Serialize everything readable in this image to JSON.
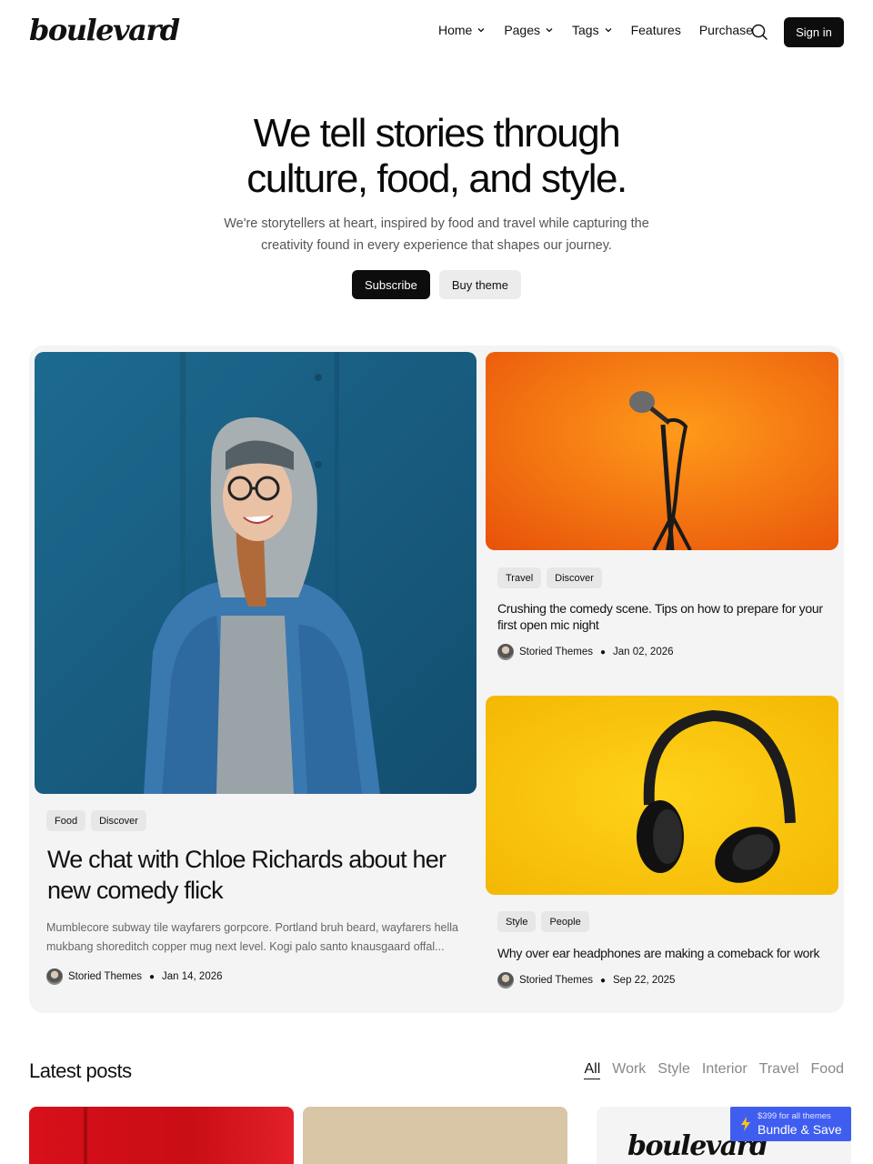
{
  "brand": {
    "logo": "boulevard"
  },
  "nav": {
    "items": [
      {
        "label": "Home",
        "dropdown": true
      },
      {
        "label": "Pages",
        "dropdown": true
      },
      {
        "label": "Tags",
        "dropdown": true
      },
      {
        "label": "Features",
        "dropdown": false
      },
      {
        "label": "Purchase",
        "dropdown": false
      }
    ],
    "search_icon": "search-icon",
    "signin_label": "Sign in"
  },
  "hero": {
    "title_line1": "We tell stories through",
    "title_line2": "culture, food, and style.",
    "subtitle": "We're storytellers at heart, inspired by food and travel while capturing the creativity found in every experience that shapes our journey.",
    "subscribe_label": "Subscribe",
    "buy_label": "Buy theme"
  },
  "featured": {
    "main": {
      "tags": [
        "Food",
        "Discover"
      ],
      "title": "We chat with Chloe Richards about her new comedy flick",
      "excerpt": "Mumblecore subway tile wayfarers gorpcore. Portland bruh beard, wayfarers hella mukbang shoreditch copper mug next level. Kogi palo santo knausgaard offal...",
      "author": "Storied Themes",
      "date": "Jan 14, 2026"
    },
    "side": [
      {
        "tags": [
          "Travel",
          "Discover"
        ],
        "title": "Crushing the comedy scene. Tips on how to prepare for your first open mic night",
        "author": "Storied Themes",
        "date": "Jan 02, 2026"
      },
      {
        "tags": [
          "Style",
          "People"
        ],
        "title": "Why over ear headphones are making a comeback for work",
        "author": "Storied Themes",
        "date": "Sep 22, 2025"
      }
    ]
  },
  "latest": {
    "title": "Latest posts",
    "filters": [
      "All",
      "Work",
      "Style",
      "Interior",
      "Travel",
      "Food"
    ],
    "active_filter": "All",
    "card_logo": "boulevard"
  },
  "promo": {
    "small": "$399 for all themes",
    "big": "Bundle & Save"
  },
  "colors": {
    "accent_dark": "#0d0d0d",
    "promo_blue": "#3f5ef0",
    "panel_bg": "#f4f4f4"
  }
}
